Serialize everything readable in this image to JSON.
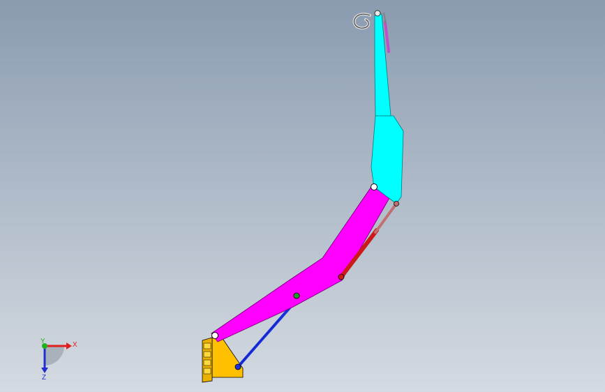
{
  "viewport": {
    "background_top": "#8a9bb0",
    "background_bottom": "#d4dae1"
  },
  "crane": {
    "base_color": "#ffc000",
    "main_boom_color": "#ff00ff",
    "upper_boom_color": "#00ffff",
    "lower_cylinder_color": "#1a2fe0",
    "upper_cylinder_color": "#cc1a1a",
    "tip_cylinder_color": "#c050c8",
    "pin_colors": [
      "#ffffff",
      "#20a020",
      "#cc1a1a",
      "#1a2fe0"
    ]
  },
  "triad": {
    "x_label": "X",
    "y_label": "Y",
    "z_label": "Z",
    "x_color": "#e02020",
    "y_color": "#20b020",
    "z_color": "#2030d0"
  }
}
